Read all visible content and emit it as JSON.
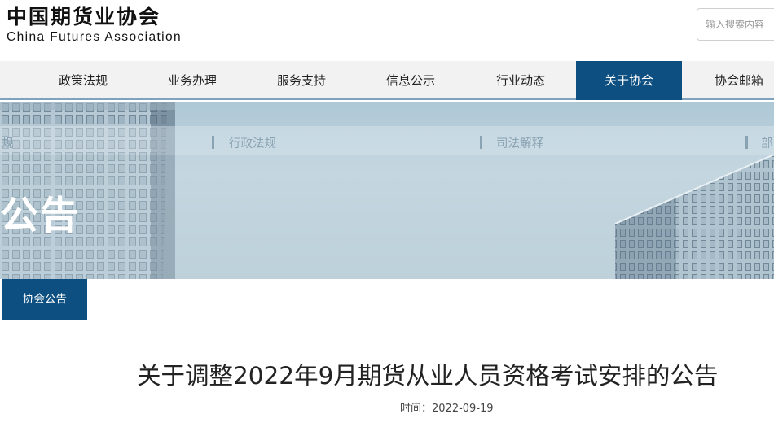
{
  "header": {
    "logo_cn": "中国期货业协会",
    "logo_en": "China Futures Association",
    "search_placeholder": "输入搜索内容"
  },
  "nav": {
    "items": [
      {
        "label": "政策法规"
      },
      {
        "label": "业务办理"
      },
      {
        "label": "服务支持"
      },
      {
        "label": "信息公示"
      },
      {
        "label": "行业动态"
      },
      {
        "label": "关于协会"
      },
      {
        "label": "协会邮箱"
      }
    ],
    "active_index": 5,
    "active_color": "#0e4f82"
  },
  "banner": {
    "sub_links": [
      {
        "label": "规"
      },
      {
        "label": "行政法规"
      },
      {
        "label": "司法解释"
      },
      {
        "label": "部"
      }
    ],
    "title": "公告"
  },
  "section": {
    "tab_label": "协会公告"
  },
  "article": {
    "title": "关于调整2022年9月期货从业人员资格考试安排的公告",
    "date_label": "时间：",
    "date": "2022-09-19"
  }
}
